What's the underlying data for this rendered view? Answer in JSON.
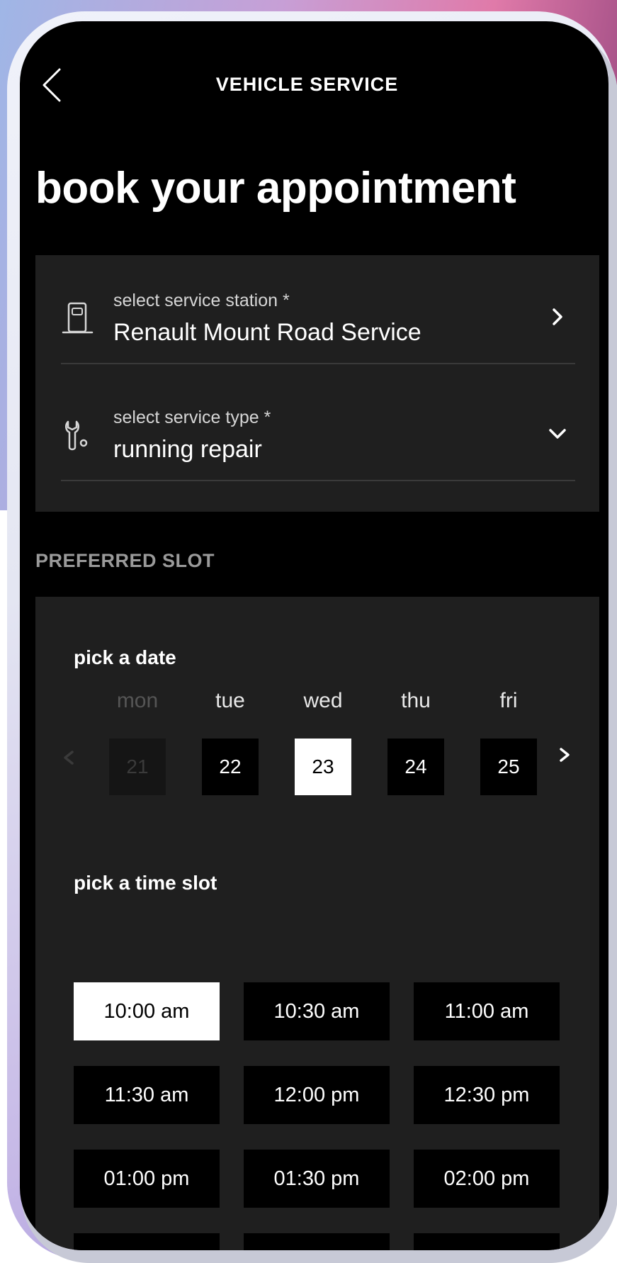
{
  "header": {
    "title": "VEHICLE SERVICE",
    "back_icon": "chevron-left-icon"
  },
  "page": {
    "title": "book your appointment"
  },
  "service": {
    "station": {
      "label": "select service station *",
      "value": "Renault Mount Road Service",
      "icon": "fuel-station-icon",
      "chevron_icon": "chevron-right-icon"
    },
    "type": {
      "label": "select service type *",
      "value": "running repair",
      "icon": "wrench-icon",
      "chevron_icon": "chevron-down-icon"
    }
  },
  "preferred_slot": {
    "section_label": "PREFERRED SLOT",
    "date_label": "pick a date",
    "time_label": "pick a time slot",
    "days": [
      {
        "name": "mon",
        "date": "21",
        "state": "disabled"
      },
      {
        "name": "tue",
        "date": "22",
        "state": "normal"
      },
      {
        "name": "wed",
        "date": "23",
        "state": "selected"
      },
      {
        "name": "thu",
        "date": "24",
        "state": "normal"
      },
      {
        "name": "fri",
        "date": "25",
        "state": "normal"
      }
    ],
    "time_slots": [
      {
        "label": "10:00 am",
        "state": "selected"
      },
      {
        "label": "10:30 am",
        "state": "normal"
      },
      {
        "label": "11:00 am",
        "state": "normal"
      },
      {
        "label": "11:30 am",
        "state": "normal"
      },
      {
        "label": "12:00 pm",
        "state": "normal"
      },
      {
        "label": "12:30 pm",
        "state": "normal"
      },
      {
        "label": "01:00 pm",
        "state": "normal"
      },
      {
        "label": "01:30 pm",
        "state": "normal"
      },
      {
        "label": "02:00 pm",
        "state": "normal"
      }
    ]
  },
  "colors": {
    "screen_bg": "#000000",
    "card_bg": "#1f1f1f",
    "selected_bg": "#ffffff",
    "muted_text": "#9a9a9a"
  }
}
